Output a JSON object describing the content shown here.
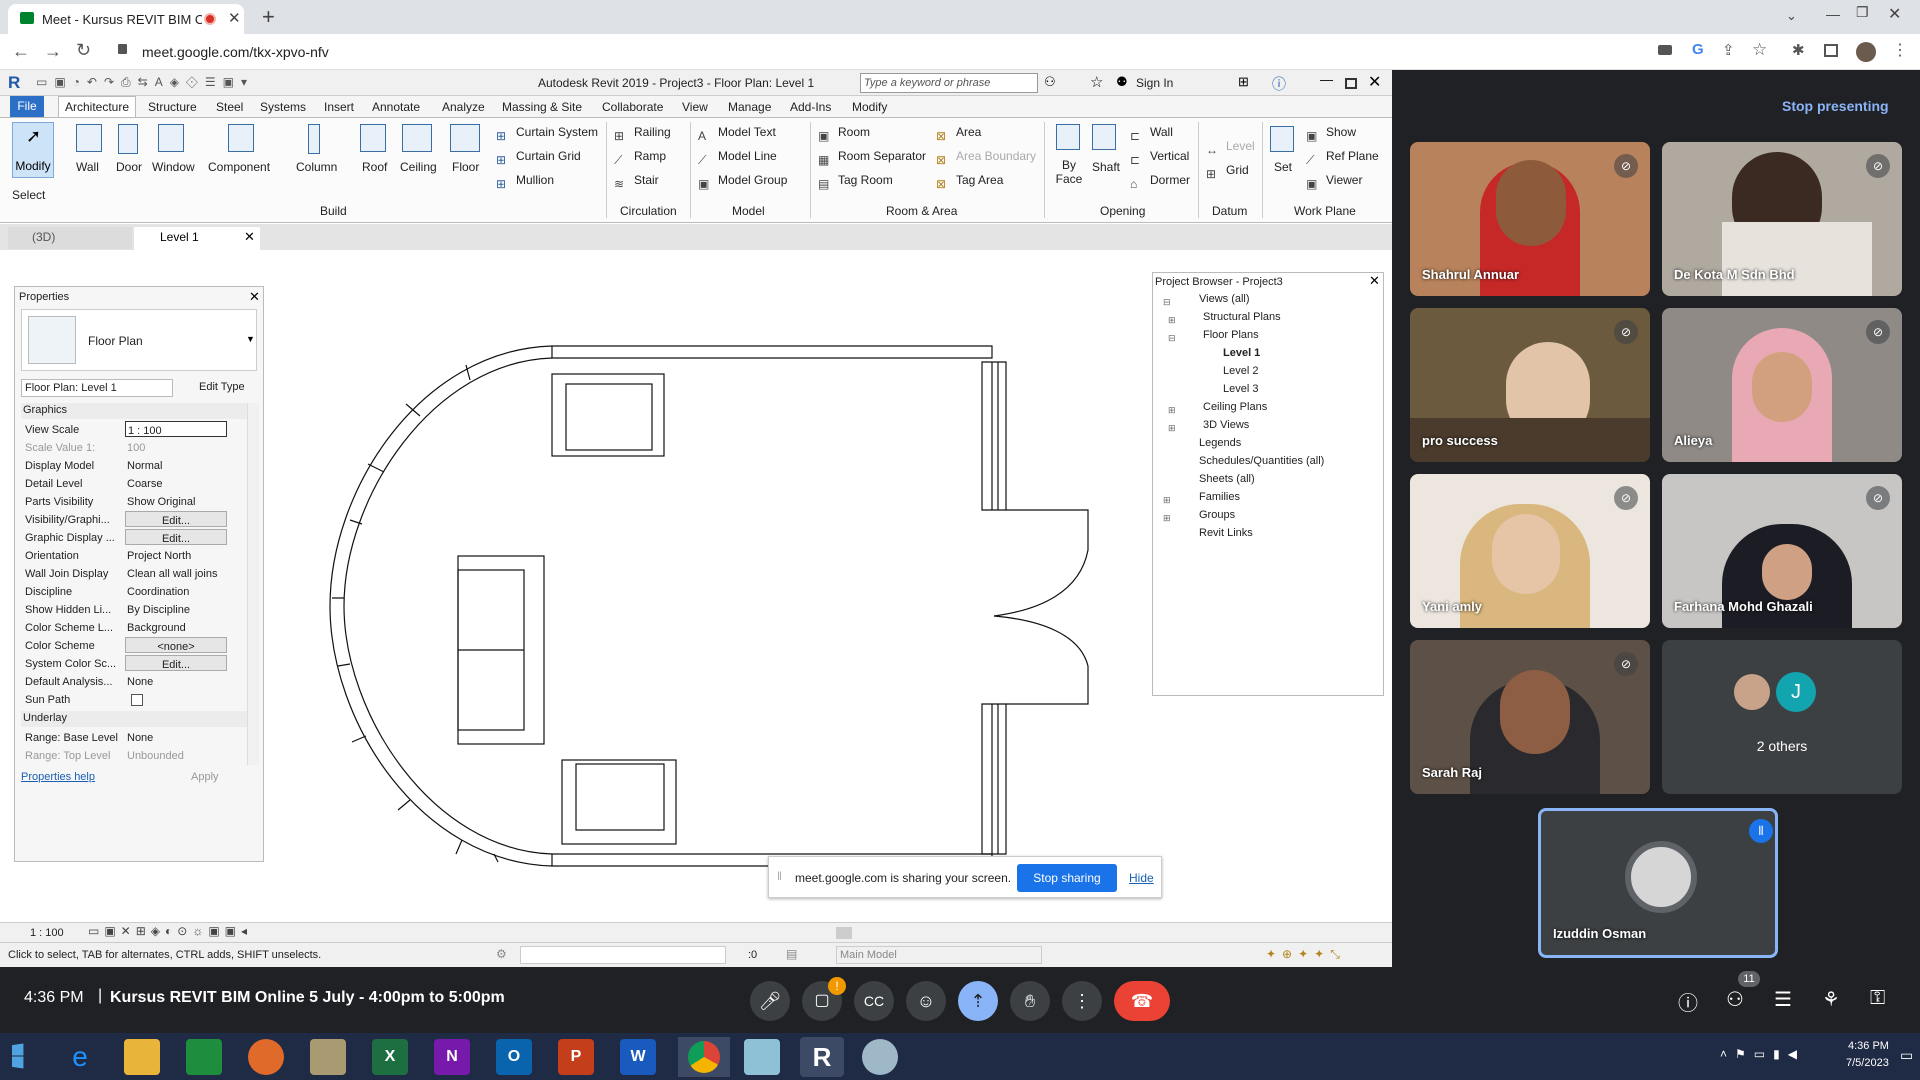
{
  "browser": {
    "tab_title": "Meet - Kursus REVIT BIM On",
    "url": "meet.google.com/tkx-xpvo-nfv"
  },
  "revit": {
    "title": "Autodesk Revit 2019 - Project3 - Floor Plan: Level 1",
    "search_placeholder": "Type a keyword or phrase",
    "sign_in": "Sign In",
    "menu": [
      "File",
      "Architecture",
      "Structure",
      "Steel",
      "Systems",
      "Insert",
      "Annotate",
      "Analyze",
      "Massing & Site",
      "Collaborate",
      "View",
      "Manage",
      "Add-Ins",
      "Modify"
    ],
    "ribbon": {
      "modify": "Modify",
      "select": "Select",
      "build": [
        "Wall",
        "Door",
        "Window",
        "Component",
        "Column",
        "Roof",
        "Ceiling",
        "Floor"
      ],
      "build_small": [
        "Curtain System",
        "Curtain Grid",
        "Mullion"
      ],
      "circulation": [
        "Railing",
        "Ramp",
        "Stair"
      ],
      "model": [
        "Model Text",
        "Model Line",
        "Model Group"
      ],
      "room": [
        "Room",
        "Room Separator",
        "Tag Room"
      ],
      "area": [
        "Area",
        "Area Boundary",
        "Tag Area"
      ],
      "opening_big": [
        "By Face",
        "Shaft"
      ],
      "opening_small": [
        "Wall",
        "Vertical",
        "Dormer"
      ],
      "datum": [
        "Level",
        "Grid"
      ],
      "set": "Set",
      "workplane": [
        "Show",
        "Ref Plane",
        "Viewer"
      ],
      "groups": [
        "Build",
        "Circulation",
        "Model",
        "Room & Area",
        "Opening",
        "Datum",
        "Work Plane"
      ]
    },
    "views_tabs": [
      "(3D)",
      "Level 1"
    ],
    "properties": {
      "title": "Properties",
      "type": "Floor Plan",
      "instance": "Floor Plan: Level 1",
      "edit_type": "Edit Type",
      "section_graphics": "Graphics",
      "section_underlay": "Underlay",
      "rows": [
        [
          "View Scale",
          "1 : 100"
        ],
        [
          "Scale Value    1:",
          "100"
        ],
        [
          "Display Model",
          "Normal"
        ],
        [
          "Detail Level",
          "Coarse"
        ],
        [
          "Parts Visibility",
          "Show Original"
        ],
        [
          "Visibility/Graphi...",
          "Edit..."
        ],
        [
          "Graphic Display ...",
          "Edit..."
        ],
        [
          "Orientation",
          "Project North"
        ],
        [
          "Wall Join Display",
          "Clean all wall joins"
        ],
        [
          "Discipline",
          "Coordination"
        ],
        [
          "Show Hidden Li...",
          "By Discipline"
        ],
        [
          "Color Scheme L...",
          "Background"
        ],
        [
          "Color Scheme",
          "<none>"
        ],
        [
          "System Color Sc...",
          "Edit..."
        ],
        [
          "Default Analysis...",
          "None"
        ],
        [
          "Sun Path",
          ""
        ]
      ],
      "underlay_rows": [
        [
          "Range: Base Level",
          "None"
        ],
        [
          "Range: Top Level",
          "Unbounded"
        ]
      ],
      "help": "Properties help",
      "apply": "Apply"
    },
    "browser": {
      "title": "Project Browser - Project3",
      "items": [
        "Views (all)",
        "Structural Plans",
        "Floor Plans",
        "Level 1",
        "Level 2",
        "Level 3",
        "Ceiling Plans",
        "3D Views",
        "Legends",
        "Schedules/Quantities (all)",
        "Sheets (all)",
        "Families",
        "Groups",
        "Revit Links"
      ]
    },
    "sharing": {
      "text": "meet.google.com is sharing your screen.",
      "stop": "Stop sharing",
      "hide": "Hide"
    },
    "scale": "1 : 100",
    "status": "Click to select, TAB for alternates, CTRL adds, SHIFT unselects.",
    "zero": ":0",
    "main_model": "Main Model"
  },
  "meet": {
    "stop_presenting": "Stop presenting",
    "participants": [
      "Shahrul Annuar",
      "De Kota M Sdn Bhd",
      "pro success",
      "Alieya",
      "Yani amly",
      "Farhana Mohd Ghazali",
      "Sarah Raj"
    ],
    "others": "2 others",
    "others_initial": "J",
    "self": "Izuddin Osman",
    "time": "4:36 PM",
    "meeting_title": "Kursus REVIT BIM Online 5 July - 4:00pm to 5:00pm",
    "people_count": "11",
    "alert": "!"
  },
  "taskbar": {
    "time": "4:36 PM",
    "date": "7/5/2023"
  }
}
